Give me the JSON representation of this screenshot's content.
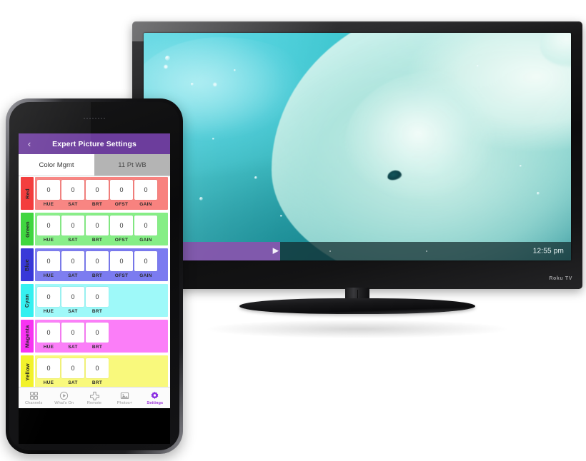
{
  "tv": {
    "brand": "Roku TV",
    "screen_content": "polar-bear-underwater",
    "playback": {
      "time_label": "12:55 pm",
      "play_icon": "play-icon",
      "progress_percent": 32
    }
  },
  "phone": {
    "app": {
      "header": {
        "back_icon": "chevron-left-icon",
        "title": "Expert Picture Settings",
        "bg_color": "#6c3d9c"
      },
      "tabs": [
        {
          "label": "Color Mgmt",
          "active": true
        },
        {
          "label": "11 Pt WB",
          "active": false
        }
      ],
      "color_rows": [
        {
          "name": "Red",
          "swatch_color": "#f23030",
          "panel_color": "#f8827f",
          "fields": [
            {
              "label": "HUE",
              "value": "0"
            },
            {
              "label": "SAT",
              "value": "0"
            },
            {
              "label": "BRT",
              "value": "0"
            },
            {
              "label": "OFST",
              "value": "0"
            },
            {
              "label": "GAIN",
              "value": "0"
            }
          ]
        },
        {
          "name": "Green",
          "swatch_color": "#35d435",
          "panel_color": "#86ee86",
          "fields": [
            {
              "label": "HUE",
              "value": "0"
            },
            {
              "label": "SAT",
              "value": "0"
            },
            {
              "label": "BRT",
              "value": "0"
            },
            {
              "label": "OFST",
              "value": "0"
            },
            {
              "label": "GAIN",
              "value": "0"
            }
          ]
        },
        {
          "name": "Blue",
          "swatch_color": "#2f2fd6",
          "panel_color": "#7b7bf0",
          "fields": [
            {
              "label": "HUE",
              "value": "0"
            },
            {
              "label": "SAT",
              "value": "0"
            },
            {
              "label": "BRT",
              "value": "0"
            },
            {
              "label": "OFST",
              "value": "0"
            },
            {
              "label": "GAIN",
              "value": "0"
            }
          ]
        },
        {
          "name": "Cyan",
          "swatch_color": "#2ef0f0",
          "panel_color": "#9ef9f9",
          "fields": [
            {
              "label": "HUE",
              "value": "0"
            },
            {
              "label": "SAT",
              "value": "0"
            },
            {
              "label": "BRT",
              "value": "0"
            }
          ]
        },
        {
          "name": "Magenta",
          "swatch_color": "#f72ef2",
          "panel_color": "#fb7ef8",
          "fields": [
            {
              "label": "HUE",
              "value": "0"
            },
            {
              "label": "SAT",
              "value": "0"
            },
            {
              "label": "BRT",
              "value": "0"
            }
          ]
        },
        {
          "name": "Yellow",
          "swatch_color": "#f2f226",
          "panel_color": "#f9f97c",
          "fields": [
            {
              "label": "HUE",
              "value": "0"
            },
            {
              "label": "SAT",
              "value": "0"
            },
            {
              "label": "BRT",
              "value": "0"
            }
          ]
        }
      ],
      "tabbar": [
        {
          "label": "Channels",
          "icon": "grid-icon",
          "active": false
        },
        {
          "label": "What's On",
          "icon": "play-circle-icon",
          "active": false
        },
        {
          "label": "Remote",
          "icon": "dpad-icon",
          "active": false
        },
        {
          "label": "Photos+",
          "icon": "image-icon",
          "active": false
        },
        {
          "label": "Settings",
          "icon": "gear-icon",
          "active": true
        }
      ],
      "accent_color": "#9b30d9"
    }
  }
}
